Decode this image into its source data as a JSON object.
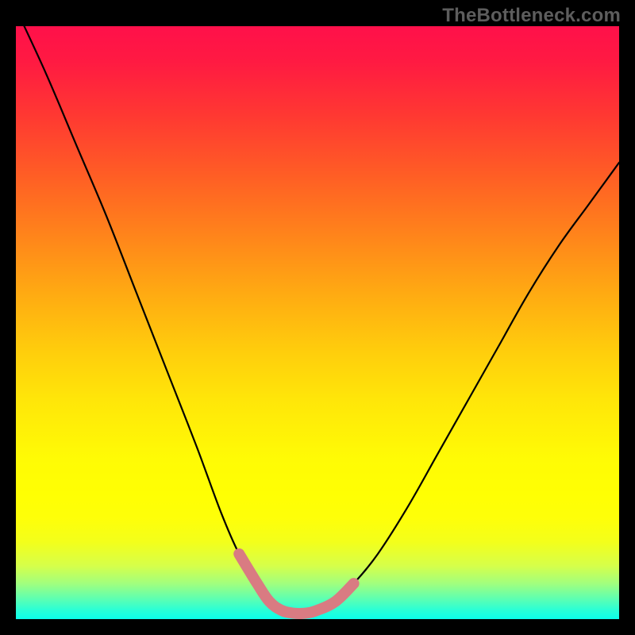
{
  "watermark": "TheBottleneck.com",
  "chart_data": {
    "type": "line",
    "title": "",
    "xlabel": "",
    "ylabel": "",
    "xlim": [
      0,
      100
    ],
    "ylim": [
      0,
      100
    ],
    "series": [
      {
        "name": "bottleneck-curve",
        "x": [
          0,
          5,
          10,
          15,
          20,
          25,
          30,
          34,
          37,
          40,
          42,
          44,
          46,
          48,
          50,
          53,
          56,
          60,
          65,
          70,
          75,
          80,
          85,
          90,
          95,
          100
        ],
        "values": [
          103,
          92,
          80,
          68,
          55,
          42,
          29,
          18,
          11,
          6,
          3,
          1.5,
          1,
          1,
          1.5,
          3,
          6,
          11,
          19,
          28,
          37,
          46,
          55,
          63,
          70,
          77
        ]
      }
    ],
    "highlight": {
      "name": "bottom-arc-highlight",
      "x": [
        37,
        40,
        42,
        44,
        46,
        48,
        50,
        53,
        56
      ],
      "values": [
        11,
        6,
        3,
        1.5,
        1,
        1,
        1.5,
        3,
        6
      ]
    },
    "background_gradient": {
      "top_color": "#ff104a",
      "mid_color": "#ffff03",
      "bottom_color": "#0bffeb"
    }
  }
}
